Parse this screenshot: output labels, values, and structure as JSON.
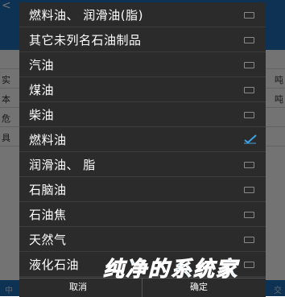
{
  "background": {
    "back_glyph": "<",
    "rows": [
      {
        "left": "",
        "right": ""
      },
      {
        "left": "实",
        "right": "吨"
      },
      {
        "left": "本",
        "right": "吨"
      },
      {
        "left": "危",
        "right": ""
      },
      {
        "left": "具",
        "right": ""
      }
    ],
    "bottom_left": "中",
    "bottom_right": "交"
  },
  "dialog": {
    "options": [
      {
        "label": "燃料油、 润滑油(脂)",
        "checked": false
      },
      {
        "label": "其它未列名石油制品",
        "checked": false
      },
      {
        "label": "汽油",
        "checked": false
      },
      {
        "label": "煤油",
        "checked": false
      },
      {
        "label": "柴油",
        "checked": false
      },
      {
        "label": "燃料油",
        "checked": true
      },
      {
        "label": "润滑油、 脂",
        "checked": false
      },
      {
        "label": "石脑油",
        "checked": false
      },
      {
        "label": "石油焦",
        "checked": false
      },
      {
        "label": "天然气",
        "checked": false
      },
      {
        "label": "液化石油",
        "checked": false
      }
    ],
    "cancel_label": "取消",
    "ok_label": "确定"
  },
  "watermark": "纯净的系统家",
  "colors": {
    "dialog_bg": "#2b2b2b",
    "check_accent": "#3fa3e6",
    "app_bar": "#1d6fb8",
    "watermark": "#2a9df4"
  }
}
